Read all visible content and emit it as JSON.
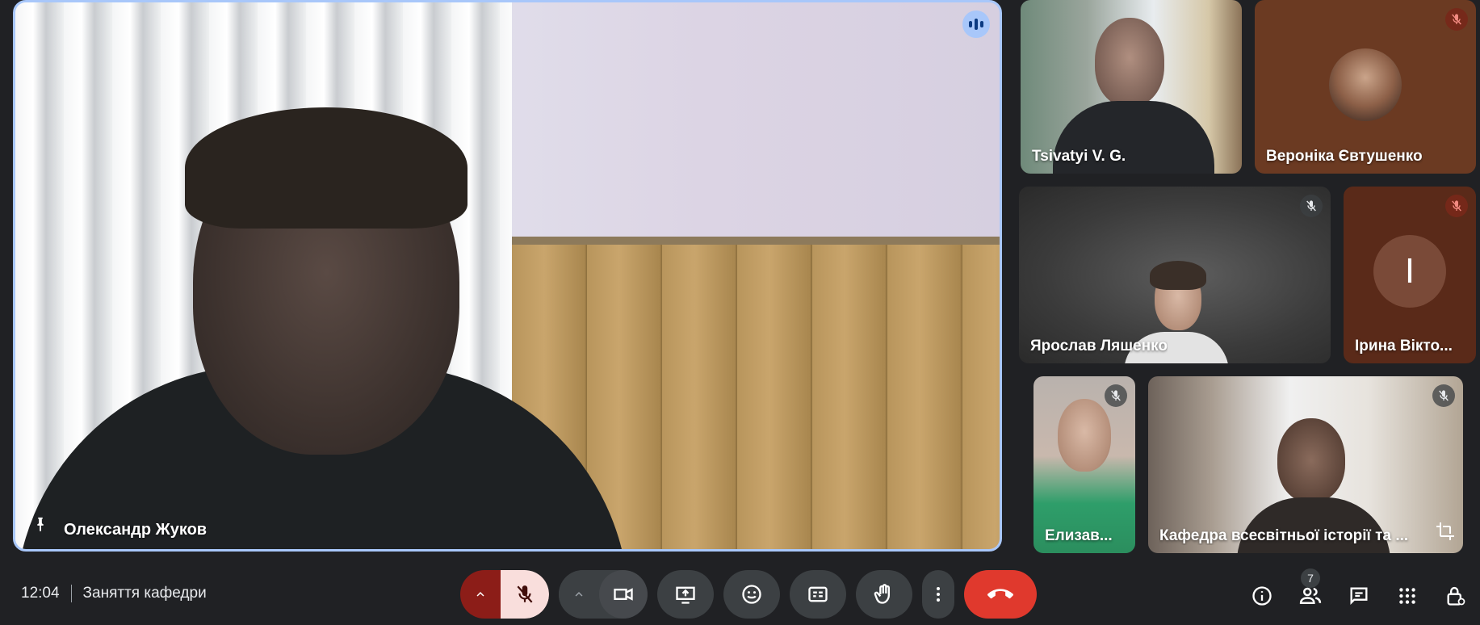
{
  "main_speaker": {
    "name": "Олександр Жуков"
  },
  "participants": [
    {
      "name": "Tsivatyi V. G."
    },
    {
      "name": "Вероніка Євтушенко"
    },
    {
      "name": "Ярослав Ляшенко"
    },
    {
      "name": "Ірина Вікто...",
      "avatar_letter": "I"
    },
    {
      "name": "Елизав..."
    },
    {
      "name": "Кафедра всесвітньої історії та ..."
    }
  ],
  "bottom_bar": {
    "time": "12:04",
    "meeting_title": "Заняття кафедри",
    "participant_count": "7"
  },
  "colors": {
    "background": "#202124",
    "speaking_border": "#a8c7fa",
    "end_call": "#e0392d",
    "mic_muted_bg": "#f9dedc",
    "mic_arrow_bg": "#8c1d18"
  },
  "icons": [
    "pin-icon",
    "speaking-indicator-icon",
    "mic-off-icon",
    "crop-icon",
    "chevron-up-icon",
    "camera-icon",
    "present-screen-icon",
    "emoji-icon",
    "captions-icon",
    "raise-hand-icon",
    "more-vert-icon",
    "end-call-icon",
    "info-icon",
    "people-icon",
    "chat-icon",
    "apps-icon",
    "host-controls-icon"
  ]
}
